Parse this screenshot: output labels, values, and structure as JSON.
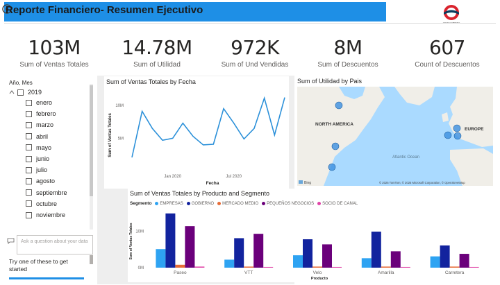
{
  "header": {
    "title": "Reporte Financiero- Resumen Ejecutivo",
    "logo_caption": "YOUR COMPANY"
  },
  "kpis": [
    {
      "value": "103M",
      "label": "Sum of Ventas Totales"
    },
    {
      "value": "14.78M",
      "label": "Sum of Utilidad"
    },
    {
      "value": "972K",
      "label": "Sum of Und Vendidas"
    },
    {
      "value": "8M",
      "label": "Sum of Descuentos"
    },
    {
      "value": "607",
      "label": "Count of Descuentos"
    }
  ],
  "slicer": {
    "title": "Año, Mes",
    "year": "2019",
    "months": [
      "enero",
      "febrero",
      "marzo",
      "abril",
      "mayo",
      "junio",
      "julio",
      "agosto",
      "septiembre",
      "octubre",
      "noviembre"
    ]
  },
  "qna": {
    "placeholder": "Ask a question about your data",
    "hint": "Try one of these to get started"
  },
  "colors": {
    "accent": "#1e8fe6",
    "line": "#2b90d9",
    "empresas": "#2ea3f2",
    "gobierno": "#12239e",
    "mercado_medio": "#e66c37",
    "pequenos_negocios": "#6b007b",
    "socio_de_canal": "#e044a7"
  },
  "map": {
    "title": "Sum of Utilidad by Pais",
    "label_na": "NORTH AMERICA",
    "label_eu": "EUROPE",
    "label_ocean": "Atlantic Ocean",
    "bing": "Bing",
    "attribution": "© 2025 TomTom, © 2025 Microsoft Corporation, © OpenStreetMap"
  },
  "chart_data": [
    {
      "type": "line",
      "title": "Sum of Ventas Totales by Fecha",
      "xlabel": "Fecha",
      "ylabel": "Sum of Ventas Totales",
      "x_ticks": [
        "Jan 2020",
        "Jul 2020"
      ],
      "y_ticks": [
        "5M",
        "10M"
      ],
      "ylim": [
        0,
        12
      ],
      "x": [
        "2019-09",
        "2019-10",
        "2019-11",
        "2019-12",
        "2020-01",
        "2020-02",
        "2020-03",
        "2020-04",
        "2020-05",
        "2020-06",
        "2020-07",
        "2020-08",
        "2020-09",
        "2020-10",
        "2020-11",
        "2020-12"
      ],
      "series": [
        {
          "values": [
            2.0,
            9.0,
            6.4,
            4.6,
            4.9,
            7.2,
            5.2,
            3.9,
            4.0,
            9.4,
            7.2,
            4.8,
            6.4,
            11.0,
            5.4,
            11.1
          ]
        }
      ]
    },
    {
      "type": "bar",
      "title": "Sum of Ventas Totales by Producto and Segmento",
      "legend_title": "Segmento",
      "xlabel": "Producto",
      "ylabel": "Sum of Ventas Totales",
      "y_ticks": [
        "0M",
        "10M"
      ],
      "ylim": [
        0,
        16
      ],
      "categories": [
        "Paseo",
        "VTT",
        "Velo",
        "Amarilla",
        "Carretera"
      ],
      "series": [
        {
          "name": "EMPRESAS",
          "values": [
            5.1,
            2.2,
            3.4,
            2.6,
            3.1
          ]
        },
        {
          "name": "GOBIERNO",
          "values": [
            14.9,
            8.1,
            7.8,
            9.9,
            6.1
          ]
        },
        {
          "name": "MERCADO MEDIO",
          "values": [
            0.8,
            0.3,
            0.3,
            0.3,
            0.3
          ]
        },
        {
          "name": "PEQUEÑOS NEGOCIOS",
          "values": [
            11.4,
            9.3,
            6.4,
            4.5,
            3.8
          ]
        },
        {
          "name": "SOCIO DE CANAL",
          "values": [
            0.3,
            0.2,
            0.2,
            0.2,
            0.2
          ]
        }
      ]
    }
  ]
}
